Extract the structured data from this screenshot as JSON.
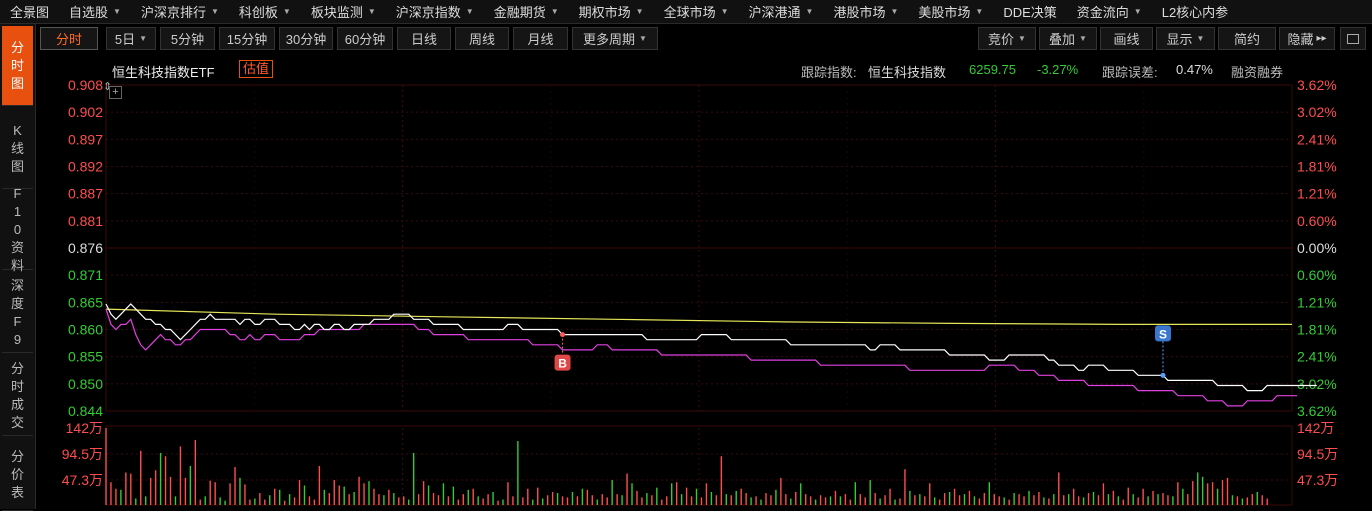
{
  "nav": {
    "items": [
      {
        "label": "全景图",
        "caret": false
      },
      {
        "label": "自选股",
        "caret": true
      },
      {
        "label": "沪深京排行",
        "caret": true
      },
      {
        "label": "科创板",
        "caret": true
      },
      {
        "label": "板块监测",
        "caret": true
      },
      {
        "label": "沪深京指数",
        "caret": true
      },
      {
        "label": "金融期货",
        "caret": true
      },
      {
        "label": "期权市场",
        "caret": true
      },
      {
        "label": "全球市场",
        "caret": true
      },
      {
        "label": "沪深港通",
        "caret": true
      },
      {
        "label": "港股市场",
        "caret": true
      },
      {
        "label": "美股市场",
        "caret": true
      },
      {
        "label": "DDE决策",
        "caret": false
      },
      {
        "label": "资金流向",
        "caret": true
      },
      {
        "label": "L2核心内参",
        "caret": false
      }
    ]
  },
  "sidebar": {
    "tabs": [
      {
        "label": "分时图",
        "active": true
      },
      {
        "label": "K线图",
        "active": false
      },
      {
        "label": "F10资料",
        "active": false
      },
      {
        "label": "深度F9",
        "active": false
      },
      {
        "label": "分时成交",
        "active": false
      },
      {
        "label": "分价表",
        "active": false
      }
    ]
  },
  "toolbar": {
    "periods": [
      {
        "label": "分时",
        "active": true,
        "caret": false
      },
      {
        "label": "5日",
        "active": false,
        "caret": true
      },
      {
        "label": "5分钟",
        "active": false,
        "caret": false
      },
      {
        "label": "15分钟",
        "active": false,
        "caret": false
      },
      {
        "label": "30分钟",
        "active": false,
        "caret": false
      },
      {
        "label": "60分钟",
        "active": false,
        "caret": false
      },
      {
        "label": "日线",
        "active": false,
        "caret": false
      },
      {
        "label": "周线",
        "active": false,
        "caret": false
      },
      {
        "label": "月线",
        "active": false,
        "caret": false
      },
      {
        "label": "更多周期",
        "active": false,
        "caret": true
      }
    ],
    "right": [
      {
        "label": "竞价",
        "caret": true
      },
      {
        "label": "叠加",
        "caret": true
      },
      {
        "label": "画线",
        "caret": false
      },
      {
        "label": "显示",
        "caret": true
      },
      {
        "label": "简约",
        "caret": false
      },
      {
        "label": "隐藏",
        "caret": false,
        "suffix": "▸▸"
      }
    ],
    "extra_icon": "window-icon"
  },
  "info": {
    "fund_name": "恒生科技指数ETF",
    "estimate_badge": "估值",
    "track_label": "跟踪指数:",
    "track_index": "恒生科技指数",
    "index_value": "6259.75",
    "index_change": "-3.27%",
    "error_label": "跟踪误差:",
    "error_value": "0.47%",
    "margin_label": "融资融券"
  },
  "colors": {
    "up": "#ff4d4d",
    "down": "#33cc33",
    "price_line": "#ffffff",
    "nav_line": "#e040e0",
    "avg_line": "#e6e65a",
    "grid": "#3a0a0a",
    "accent": "#e8500f"
  },
  "chart_data": {
    "type": "line",
    "ylim": [
      0.844,
      0.908
    ],
    "y_ticks_left": [
      "0.908",
      "0.902",
      "0.897",
      "0.892",
      "0.887",
      "0.881",
      "0.876",
      "0.871",
      "0.865",
      "0.860",
      "0.855",
      "0.850",
      "0.844"
    ],
    "y_ticks_right": [
      "3.62%",
      "3.02%",
      "2.41%",
      "1.81%",
      "1.21%",
      "0.60%",
      "0.00%",
      "0.60%",
      "1.21%",
      "1.81%",
      "2.41%",
      "3.02%",
      "3.62%"
    ],
    "prev_close": 0.876,
    "x_count": 240,
    "series": [
      {
        "key": "price",
        "values": [
          0.865,
          0.863,
          0.862,
          0.863,
          0.864,
          0.865,
          0.864,
          0.863,
          0.862,
          0.862,
          0.861,
          0.861,
          0.86,
          0.86,
          0.859,
          0.858,
          0.859,
          0.86,
          0.861,
          0.862,
          0.862,
          0.863,
          0.862,
          0.862,
          0.862,
          0.862,
          0.862,
          0.861,
          0.862,
          0.862,
          0.861,
          0.861,
          0.862,
          0.862,
          0.862,
          0.861,
          0.861,
          0.861,
          0.86,
          0.86,
          0.861,
          0.86,
          0.861,
          0.861,
          0.86,
          0.86,
          0.861,
          0.861,
          0.86,
          0.86,
          0.861,
          0.861,
          0.861,
          0.861,
          0.862,
          0.862,
          0.862,
          0.862,
          0.863,
          0.863,
          0.863,
          0.863,
          0.862,
          0.862,
          0.862,
          0.862,
          0.861,
          0.861,
          0.861,
          0.861,
          0.861,
          0.861,
          0.86,
          0.86,
          0.86,
          0.86,
          0.86,
          0.86,
          0.86,
          0.86,
          0.86,
          0.861,
          0.861,
          0.861,
          0.86,
          0.86,
          0.86,
          0.86,
          0.86,
          0.86,
          0.86,
          0.86,
          0.859,
          0.859,
          0.859,
          0.859,
          0.859,
          0.859,
          0.859,
          0.859,
          0.859,
          0.859,
          0.859,
          0.859,
          0.859,
          0.859,
          0.859,
          0.859,
          0.859,
          0.858,
          0.858,
          0.858,
          0.858,
          0.858,
          0.858,
          0.858,
          0.858,
          0.858,
          0.858,
          0.858,
          0.859,
          0.859,
          0.859,
          0.859,
          0.859,
          0.859,
          0.858,
          0.858,
          0.858,
          0.858,
          0.858,
          0.858,
          0.858,
          0.858,
          0.858,
          0.858,
          0.858,
          0.858,
          0.857,
          0.857,
          0.857,
          0.857,
          0.857,
          0.857,
          0.857,
          0.857,
          0.857,
          0.857,
          0.857,
          0.857,
          0.857,
          0.857,
          0.857,
          0.857,
          0.856,
          0.856,
          0.857,
          0.857,
          0.857,
          0.857,
          0.856,
          0.856,
          0.856,
          0.856,
          0.856,
          0.856,
          0.856,
          0.856,
          0.856,
          0.856,
          0.855,
          0.855,
          0.855,
          0.855,
          0.855,
          0.855,
          0.855,
          0.855,
          0.854,
          0.854,
          0.854,
          0.854,
          0.855,
          0.855,
          0.855,
          0.855,
          0.855,
          0.855,
          0.855,
          0.855,
          0.854,
          0.854,
          0.853,
          0.853,
          0.853,
          0.853,
          0.852,
          0.852,
          0.853,
          0.853,
          0.853,
          0.853,
          0.852,
          0.852,
          0.852,
          0.852,
          0.852,
          0.852,
          0.851,
          0.851,
          0.851,
          0.851,
          0.851,
          0.851,
          0.85,
          0.85,
          0.85,
          0.85,
          0.85,
          0.85,
          0.85,
          0.85,
          0.85,
          0.85,
          0.849,
          0.849,
          0.849,
          0.849,
          0.849,
          0.849,
          0.848,
          0.848,
          0.848,
          0.848,
          0.849,
          0.849,
          0.849,
          0.849,
          0.849,
          0.849,
          0.849,
          0.849,
          0.849,
          0.849,
          0.849
        ]
      },
      {
        "key": "nav",
        "values": [
          0.864,
          0.861,
          0.86,
          0.861,
          0.861,
          0.862,
          0.859,
          0.857,
          0.856,
          0.857,
          0.858,
          0.859,
          0.858,
          0.858,
          0.857,
          0.857,
          0.858,
          0.858,
          0.859,
          0.86,
          0.86,
          0.86,
          0.86,
          0.86,
          0.86,
          0.859,
          0.859,
          0.858,
          0.858,
          0.859,
          0.858,
          0.858,
          0.859,
          0.859,
          0.859,
          0.858,
          0.858,
          0.858,
          0.858,
          0.858,
          0.859,
          0.859,
          0.859,
          0.86,
          0.86,
          0.86,
          0.86,
          0.86,
          0.86,
          0.86,
          0.86,
          0.86,
          0.861,
          0.861,
          0.861,
          0.861,
          0.861,
          0.861,
          0.861,
          0.861,
          0.861,
          0.861,
          0.861,
          0.86,
          0.86,
          0.86,
          0.859,
          0.859,
          0.859,
          0.859,
          0.859,
          0.859,
          0.859,
          0.858,
          0.858,
          0.858,
          0.858,
          0.858,
          0.858,
          0.858,
          0.858,
          0.858,
          0.858,
          0.858,
          0.858,
          0.858,
          0.857,
          0.857,
          0.857,
          0.857,
          0.857,
          0.857,
          0.856,
          0.856,
          0.856,
          0.856,
          0.856,
          0.856,
          0.856,
          0.857,
          0.857,
          0.857,
          0.856,
          0.856,
          0.856,
          0.856,
          0.856,
          0.856,
          0.856,
          0.856,
          0.856,
          0.856,
          0.855,
          0.855,
          0.855,
          0.855,
          0.855,
          0.855,
          0.855,
          0.855,
          0.855,
          0.855,
          0.855,
          0.855,
          0.855,
          0.855,
          0.855,
          0.855,
          0.855,
          0.855,
          0.854,
          0.854,
          0.854,
          0.854,
          0.854,
          0.854,
          0.854,
          0.854,
          0.854,
          0.854,
          0.854,
          0.854,
          0.854,
          0.854,
          0.853,
          0.853,
          0.853,
          0.853,
          0.853,
          0.853,
          0.853,
          0.853,
          0.853,
          0.853,
          0.853,
          0.853,
          0.853,
          0.853,
          0.853,
          0.853,
          0.853,
          0.853,
          0.852,
          0.852,
          0.852,
          0.852,
          0.852,
          0.852,
          0.852,
          0.852,
          0.852,
          0.852,
          0.852,
          0.852,
          0.852,
          0.852,
          0.852,
          0.852,
          0.853,
          0.853,
          0.853,
          0.853,
          0.853,
          0.853,
          0.852,
          0.852,
          0.852,
          0.852,
          0.851,
          0.851,
          0.851,
          0.851,
          0.85,
          0.85,
          0.85,
          0.85,
          0.85,
          0.85,
          0.849,
          0.849,
          0.849,
          0.849,
          0.849,
          0.849,
          0.849,
          0.849,
          0.849,
          0.849,
          0.848,
          0.848,
          0.848,
          0.848,
          0.848,
          0.848,
          0.848,
          0.848,
          0.847,
          0.847,
          0.847,
          0.847,
          0.847,
          0.847,
          0.846,
          0.846,
          0.846,
          0.846,
          0.845,
          0.845,
          0.845,
          0.845,
          0.846,
          0.846,
          0.846,
          0.846,
          0.846,
          0.846,
          0.847,
          0.847,
          0.847,
          0.847,
          0.847
        ]
      },
      {
        "key": "avg",
        "values": [
          0.864,
          0.863,
          0.8625,
          0.862,
          0.8615,
          0.8612,
          0.861,
          0.861
        ]
      }
    ],
    "signals": [
      {
        "label": "B",
        "index": 92
      },
      {
        "label": "S",
        "index": 213
      }
    ],
    "volume_ticks": [
      "142万",
      "94.5万",
      "47.3万"
    ],
    "volume_max": 142,
    "volume": [
      150,
      42,
      30,
      28,
      60,
      58,
      12,
      100,
      16,
      50,
      64,
      96,
      90,
      52,
      16,
      108,
      50,
      72,
      120,
      10,
      16,
      45,
      42,
      14,
      8,
      40,
      70,
      50,
      38,
      10,
      12,
      22,
      10,
      18,
      30,
      28,
      8,
      20,
      14,
      46,
      36,
      16,
      10,
      72,
      28,
      22,
      46,
      36,
      34,
      20,
      24,
      52,
      40,
      44,
      30,
      20,
      18,
      28,
      22,
      14,
      16,
      10,
      96,
      20,
      44,
      36,
      22,
      18,
      40,
      16,
      34,
      10,
      20,
      28,
      30,
      16,
      12,
      20,
      24,
      8,
      10,
      42,
      16,
      118,
      14,
      30,
      10,
      32,
      12,
      18,
      24,
      22,
      16,
      14,
      24,
      16,
      30,
      28,
      18,
      10,
      20,
      14,
      46,
      20,
      18,
      58,
      40,
      26,
      14,
      22,
      18,
      32,
      10,
      16,
      40,
      42,
      20,
      32,
      16,
      30,
      14,
      40,
      24,
      18,
      90,
      20,
      18,
      26,
      30,
      22,
      14,
      16,
      10,
      22,
      18,
      28,
      50,
      20,
      12,
      24,
      40,
      20,
      16,
      10,
      18,
      14,
      16,
      26,
      16,
      20,
      10,
      42,
      20,
      14,
      46,
      22,
      12,
      18,
      30,
      10,
      12,
      66,
      26,
      18,
      20,
      16,
      40,
      14,
      10,
      22,
      24,
      30,
      18,
      20,
      26,
      16,
      12,
      22,
      42,
      20,
      16,
      14,
      10,
      22,
      20,
      16,
      26,
      18,
      24,
      14,
      12,
      20,
      60,
      18,
      20,
      30,
      16,
      14,
      22,
      24,
      18,
      40,
      20,
      26,
      16,
      10,
      32,
      20,
      14,
      30,
      16,
      26,
      20,
      22,
      18,
      16,
      42,
      30,
      20,
      44,
      60,
      52,
      40,
      42,
      30,
      46,
      50,
      18,
      16,
      12,
      14,
      20,
      24,
      18,
      12
    ],
    "volume_up": [
      1,
      1,
      1,
      0,
      1,
      1,
      0,
      1,
      0,
      1,
      1,
      0,
      1,
      1,
      0,
      1,
      1,
      0,
      1,
      1,
      0,
      1,
      1,
      0,
      0,
      1,
      1,
      0,
      1,
      1,
      0,
      1,
      1,
      0,
      1,
      0,
      1,
      0,
      1,
      1,
      0,
      1,
      1,
      1,
      0,
      1,
      1,
      1,
      0,
      1,
      0,
      1,
      1,
      0,
      1,
      1,
      0,
      1,
      0,
      1,
      1,
      0,
      0,
      1,
      1,
      0,
      1,
      1,
      0,
      1,
      0,
      1,
      1,
      0,
      1,
      0,
      1,
      1,
      0,
      1,
      0,
      1,
      1,
      0,
      1,
      1,
      0,
      1,
      0,
      1,
      1,
      0,
      1,
      1,
      0,
      1,
      0,
      1,
      1,
      0,
      1,
      1,
      0,
      1,
      0,
      1,
      0,
      1,
      1,
      0,
      1,
      0,
      1,
      1,
      0,
      1,
      0,
      1,
      1,
      0,
      1,
      1,
      0,
      1,
      1,
      0,
      1,
      0,
      1,
      1,
      0,
      1,
      0,
      1,
      1,
      0,
      1,
      1,
      0,
      1,
      0,
      1,
      1,
      0,
      1,
      1,
      0,
      1,
      0,
      1,
      1,
      0,
      1,
      1,
      0,
      1,
      0,
      1,
      1,
      0,
      1,
      1,
      0,
      1,
      0,
      1,
      1,
      0,
      1,
      1,
      0,
      1,
      1,
      0,
      1,
      0,
      1,
      1,
      0,
      1,
      1,
      0,
      1,
      0,
      1,
      1,
      0,
      1,
      1,
      0,
      1,
      0,
      1,
      1,
      0,
      1,
      1,
      0,
      1,
      0,
      1,
      1,
      0,
      1,
      0,
      1,
      1,
      0,
      1,
      1,
      0,
      1,
      0,
      1,
      1,
      0,
      1,
      0,
      1,
      1,
      0,
      0,
      1,
      1,
      0,
      1,
      1,
      0,
      1,
      0,
      1,
      1,
      0,
      1,
      1,
      0,
      1,
      1,
      0,
      1
    ]
  }
}
